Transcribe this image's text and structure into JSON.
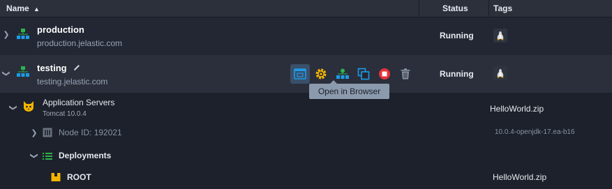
{
  "header": {
    "name_label": "Name",
    "status_label": "Status",
    "tags_label": "Tags"
  },
  "environments": [
    {
      "name": "production",
      "url": "production.jelastic.com",
      "status": "Running"
    },
    {
      "name": "testing",
      "url": "testing.jelastic.com",
      "status": "Running"
    }
  ],
  "toolbar": {
    "tooltip": "Open in Browser",
    "icons": [
      "open-in-browser-icon",
      "settings-icon",
      "topology-icon",
      "clone-icon",
      "stop-icon",
      "delete-icon"
    ]
  },
  "nodes": {
    "group_label": "Application Servers",
    "group_version": "Tomcat 10.0.4",
    "group_tag": "HelloWorld.zip",
    "node_label": "Node ID: 192021",
    "node_tag": "10.0.4-openjdk-17.ea-b16",
    "deployments_label": "Deployments",
    "root_label": "ROOT",
    "root_tag": "HelloWorld.zip"
  },
  "colors": {
    "accent_blue": "#1e9be7",
    "accent_green": "#2fb34a",
    "accent_yellow": "#f5b400",
    "stop_red": "#e5333d"
  }
}
